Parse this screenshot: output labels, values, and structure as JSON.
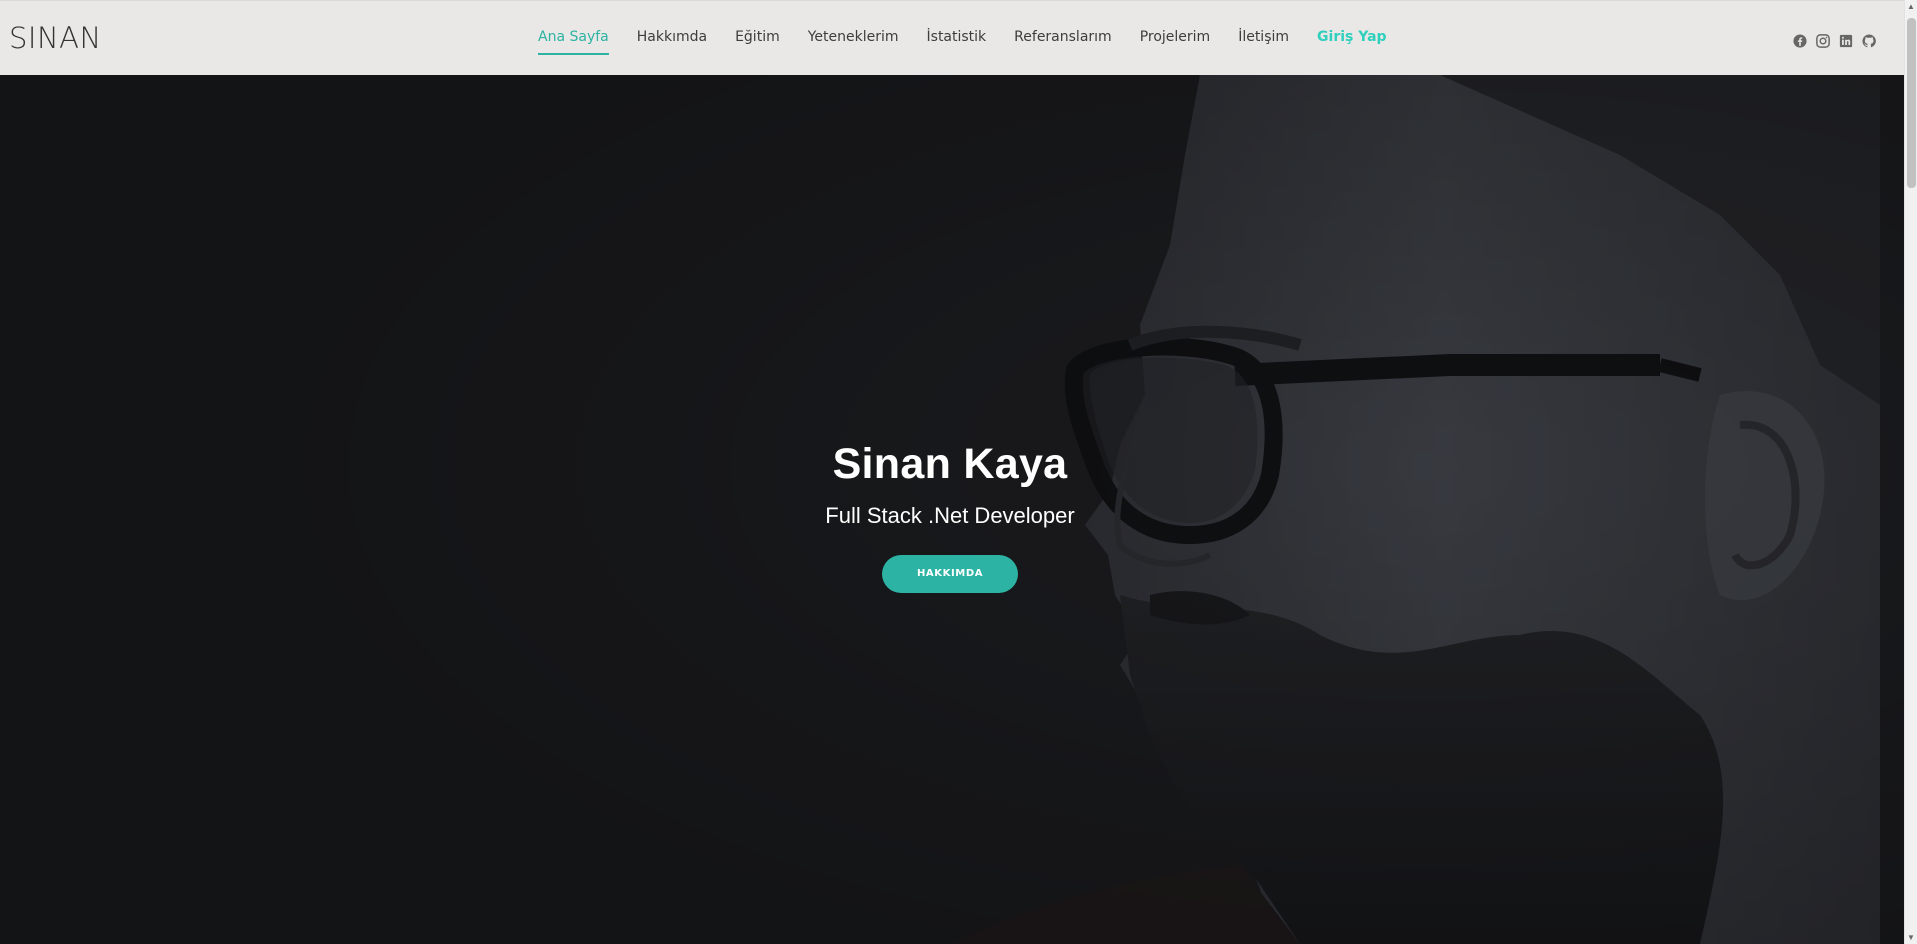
{
  "header": {
    "logo": "SINAN",
    "nav": [
      {
        "label": "Ana Sayfa",
        "active": true
      },
      {
        "label": "Hakkımda"
      },
      {
        "label": "Eğitim"
      },
      {
        "label": "Yeteneklerim"
      },
      {
        "label": "İstatistik"
      },
      {
        "label": "Referanslarım"
      },
      {
        "label": "Projelerim"
      },
      {
        "label": "İletişim"
      },
      {
        "label": "Giriş Yap",
        "highlight": true
      }
    ],
    "socials": [
      "facebook-icon",
      "instagram-icon",
      "linkedin-icon",
      "github-icon"
    ]
  },
  "hero": {
    "name": "Sinan Kaya",
    "role": "Full Stack .Net Developer",
    "button_label": "HAKKIMDA"
  },
  "colors": {
    "accent": "#2db3a3",
    "login": "#2fd0bd",
    "hero_bg": "#232428",
    "header_bg": "#e9e8e6"
  }
}
